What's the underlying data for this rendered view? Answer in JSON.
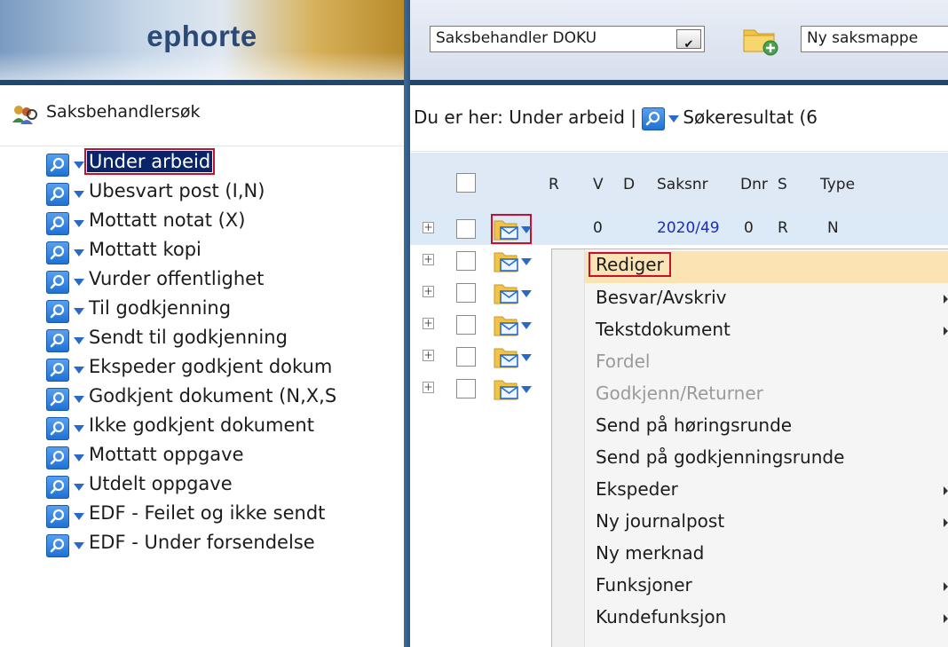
{
  "app": {
    "logo": "ephorte"
  },
  "left": {
    "search_header": "Saksbehandlersøk",
    "items": [
      "Under arbeid",
      "Ubesvart post (I,N)",
      "Mottatt notat (X)",
      "Mottatt kopi",
      "Vurder offentlighet",
      "Til godkjenning",
      "Sendt til godkjenning",
      "Ekspeder godkjent dokum",
      "Godkjent dokument (N,X,S",
      "Ikke godkjent dokument",
      "Mottatt oppgave",
      "Utdelt oppgave",
      "EDF - Feilet og ikke sendt",
      "EDF - Under forsendelse"
    ]
  },
  "toolbar": {
    "role_select": "Saksbehandler DOKU",
    "new_case_select": "Ny saksmappe"
  },
  "breadcrumb": {
    "prefix": "Du er her: Under arbeid |",
    "result": "Søkeresultat (6"
  },
  "grid": {
    "headers": {
      "r": "R",
      "v": "V",
      "d": "D",
      "saksnr": "Saksnr",
      "dnr": "Dnr",
      "s": "S",
      "type": "Type"
    },
    "first_row": {
      "v": "0",
      "saksnr": "2020/49",
      "dnr": "0",
      "s": "R",
      "type": "N"
    }
  },
  "context_menu": {
    "items": [
      {
        "label": "Rediger",
        "disabled": false,
        "submenu": false
      },
      {
        "label": "Besvar/Avskriv",
        "disabled": false,
        "submenu": true
      },
      {
        "label": "Tekstdokument",
        "disabled": false,
        "submenu": true
      },
      {
        "label": "Fordel",
        "disabled": true,
        "submenu": false
      },
      {
        "label": "Godkjenn/Returner",
        "disabled": true,
        "submenu": false
      },
      {
        "label": "Send på høringsrunde",
        "disabled": false,
        "submenu": false
      },
      {
        "label": "Send på godkjenningsrunde",
        "disabled": false,
        "submenu": false
      },
      {
        "label": "Ekspeder",
        "disabled": false,
        "submenu": true
      },
      {
        "label": "Ny journalpost",
        "disabled": false,
        "submenu": true
      },
      {
        "label": "Ny merknad",
        "disabled": false,
        "submenu": false
      },
      {
        "label": "Funksjoner",
        "disabled": false,
        "submenu": true
      },
      {
        "label": "Kundefunksjon",
        "disabled": false,
        "submenu": true
      }
    ]
  },
  "colors": {
    "selection_outline": "#c8102e",
    "selected_bg": "#0a246a",
    "menu_highlight": "#fbe3b3",
    "link_blue": "#1b2fb0",
    "header_blue": "#23466d"
  },
  "icons": [
    "ephorte-logo",
    "people-search-icon",
    "magnifier-icon",
    "dropdown-arrow-icon",
    "new-folder-icon",
    "folder-envelope-icon",
    "expand-plus-icon",
    "submenu-arrow-icon"
  ]
}
